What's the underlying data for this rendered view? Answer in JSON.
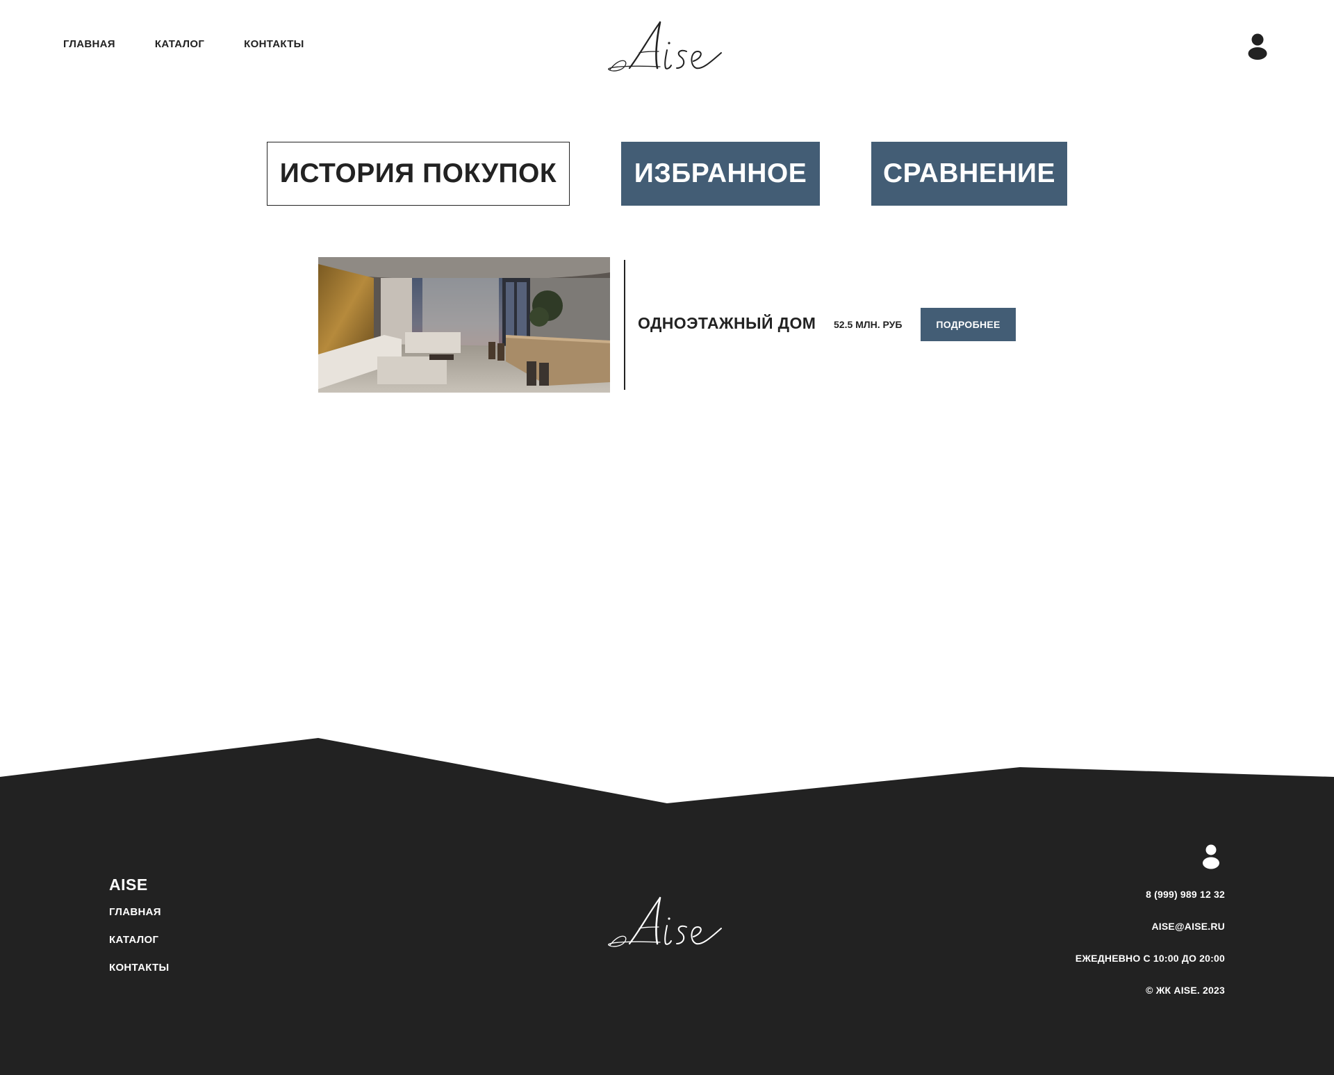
{
  "header": {
    "nav": [
      "ГЛАВНАЯ",
      "КАТАЛОГ",
      "КОНТАКТЫ"
    ],
    "logo_text": "Aise",
    "profile_icon": "user-icon"
  },
  "tabs": [
    {
      "label": "ИСТОРИЯ ПОКУПОК",
      "active": true
    },
    {
      "label": "ИЗБРАННОЕ",
      "active": false
    },
    {
      "label": "СРАВНЕНИЕ",
      "active": false
    }
  ],
  "item": {
    "title": "ОДНОЭТАЖНЫЙ ДОМ",
    "price": "52.5 МЛН. РУБ",
    "more_label": "ПОДРОБНЕЕ",
    "photo": "interior-photo"
  },
  "footer": {
    "brand": "AISE",
    "nav": [
      "ГЛАВНАЯ",
      "КАТАЛОГ",
      "КОНТАКТЫ"
    ],
    "logo_text": "Aise",
    "phone": "8 (999) 989 12 32",
    "email": "AISE@AISE.RU",
    "hours": "ЕЖЕДНЕВНО С 10:00 ДО 20:00",
    "copyright": "© ЖК AISE. 2023",
    "profile_icon": "user-icon"
  },
  "colors": {
    "accent": "#435d75",
    "text": "#222222",
    "footer_bg": "#222222",
    "background": "#ffffff"
  }
}
